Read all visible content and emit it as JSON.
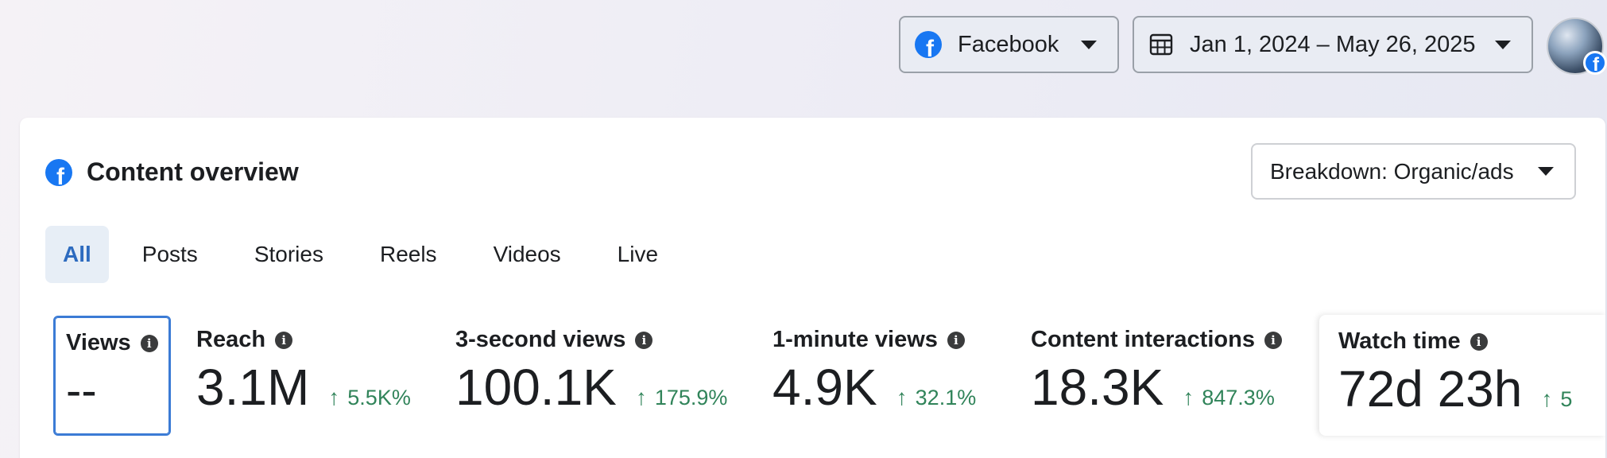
{
  "header": {
    "platform_label": "Facebook",
    "date_range_label": "Jan 1, 2024 – May 26, 2025"
  },
  "card": {
    "title": "Content overview",
    "breakdown_label": "Breakdown: Organic/ads",
    "tabs": [
      {
        "label": "All",
        "active": true
      },
      {
        "label": "Posts"
      },
      {
        "label": "Stories"
      },
      {
        "label": "Reels"
      },
      {
        "label": "Videos"
      },
      {
        "label": "Live"
      }
    ],
    "metrics": [
      {
        "label": "Views",
        "value": "--",
        "change": ""
      },
      {
        "label": "Reach",
        "value": "3.1M",
        "change": "5.5K%"
      },
      {
        "label": "3-second views",
        "value": "100.1K",
        "change": "175.9%"
      },
      {
        "label": "1-minute views",
        "value": "4.9K",
        "change": "32.1%"
      },
      {
        "label": "Content interactions",
        "value": "18.3K",
        "change": "847.3%"
      },
      {
        "label": "Watch time",
        "value": "72d 23h",
        "change": "5"
      }
    ]
  },
  "icons": {
    "info": "i",
    "up_arrow": "↑",
    "fb_glyph": "f"
  },
  "colors": {
    "accent_blue": "#1877f2",
    "active_tab_text": "#2d6bbf",
    "positive_change": "#31845a",
    "selected_metric_border": "#3b7bd5"
  }
}
